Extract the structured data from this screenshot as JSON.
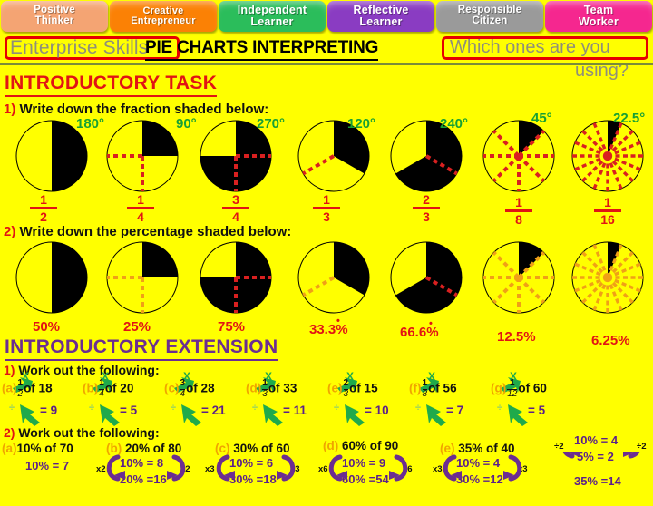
{
  "tabs": [
    {
      "line1": "Positive",
      "line2": "Thinker",
      "color": "#f4a473"
    },
    {
      "line1": "Creative",
      "line2": "Entrepreneur",
      "color": "#fb8105"
    },
    {
      "line1": "Independent",
      "line2": "Learner",
      "color": "#2bbd5b"
    },
    {
      "line1": "Reflective",
      "line2": "Learner",
      "color": "#8a3cc2"
    },
    {
      "line1": "Responsible",
      "line2": "Citizen",
      "color": "#9a9a9a"
    },
    {
      "line1": "Team",
      "line2": "Worker",
      "color": "#f5278f"
    }
  ],
  "header": {
    "enterprise_skills": "Enterprise Skills",
    "title": "PIE CHARTS INTERPRETING",
    "which_line1": "Which ones are you",
    "which_line2": "using?"
  },
  "sections": {
    "introductory_task": "INTRODUCTORY TASK",
    "introductory_extension": "INTRODUCTORY EXTENSION"
  },
  "questions": {
    "q1_num": "1)",
    "q1_text": " Write down the fraction shaded below:",
    "q2_num": "2)",
    "q2_text": " Write down the percentage shaded below:",
    "q3_num": "1)",
    "q3_text": " Work out the following:",
    "q4_num": "2)",
    "q4_text": " Work out the following:"
  },
  "chart_data": {
    "type": "pie",
    "title": "PIE CHARTS INTERPRETING",
    "row1_label": "Write down the fraction shaded below",
    "row2_label": "Write down the percentage shaded below",
    "series": [
      {
        "degrees": "180°",
        "fraction_num": "1",
        "fraction_den": "2",
        "percent": "50%",
        "shaded_deg": 180,
        "sectors": 2
      },
      {
        "degrees": "90°",
        "fraction_num": "1",
        "fraction_den": "4",
        "percent": "25%",
        "shaded_deg": 90,
        "sectors": 4
      },
      {
        "degrees": "270°",
        "fraction_num": "3",
        "fraction_den": "4",
        "percent": "75%",
        "shaded_deg": 270,
        "sectors": 4
      },
      {
        "degrees": "120°",
        "fraction_num": "1",
        "fraction_den": "3",
        "percent": "33.3%",
        "percent_dot": true,
        "shaded_deg": 120,
        "sectors": 3
      },
      {
        "degrees": "240°",
        "fraction_num": "2",
        "fraction_den": "3",
        "percent": "66.6%",
        "percent_dot": true,
        "shaded_deg": 240,
        "sectors": 3
      },
      {
        "degrees": "45°",
        "fraction_num": "1",
        "fraction_den": "8",
        "percent": "12.5%",
        "shaded_deg": 45,
        "sectors": 8
      },
      {
        "degrees": "22.5°",
        "fraction_num": "1",
        "fraction_den": "16",
        "percent": "6.25%",
        "shaded_deg": 22.5,
        "sectors": 16
      }
    ]
  },
  "extension1": [
    {
      "label": "(a)",
      "num": "1",
      "den": "2",
      "of": "of 18",
      "answer": "= 9"
    },
    {
      "label": "(b)",
      "num": "1",
      "den": "4",
      "of": "of 20",
      "answer": "= 5"
    },
    {
      "label": "(c)",
      "num": "3",
      "den": "4",
      "of": "of 28",
      "answer": "= 21"
    },
    {
      "label": "(d)",
      "num": "1",
      "den": "3",
      "of": "of 33",
      "answer": "= 11"
    },
    {
      "label": "(e)",
      "num": "2",
      "den": "3",
      "of": "of 15",
      "answer": "= 10"
    },
    {
      "label": "(f)",
      "num": "1",
      "den": "8",
      "of": "of 56",
      "answer": "= 7"
    },
    {
      "label": "(g)",
      "num": "1",
      "den": "12",
      "of": "of 60",
      "answer": "= 5"
    }
  ],
  "extension2": [
    {
      "label": "(a)",
      "question": "10% of 70",
      "lines": [
        "10% = 7"
      ],
      "mult_left": "",
      "mult_right": ""
    },
    {
      "label": "(b)",
      "question": "20% of 80",
      "lines": [
        "10% = 8",
        "20% =16"
      ],
      "mult_left": "x2",
      "mult_right": "x2"
    },
    {
      "label": "(c)",
      "question": "30% of 60",
      "lines": [
        "10% = 6",
        "30% =18"
      ],
      "mult_left": "x3",
      "mult_right": "x3"
    },
    {
      "label": "(d)",
      "question": "60% of 90",
      "lines": [
        "10% = 9",
        "60% =54"
      ],
      "mult_left": "x6",
      "mult_right": "x6"
    },
    {
      "label": "(e)",
      "question": "35% of 40",
      "lines": [
        "10% = 4",
        "30% =12"
      ],
      "mult_left": "x3",
      "mult_right": "x3",
      "extra": {
        "lines": [
          "10% = 4",
          "5% = 2"
        ],
        "mult_left": "÷2",
        "mult_right": "÷2",
        "total": "35% =14"
      }
    }
  ],
  "colors": {
    "background": "#ffff00",
    "red": "#e11414",
    "green": "#17a034",
    "purple": "#6b2d91",
    "answer_purple": "#5b1f8a",
    "orange_label": "#f0a500",
    "gray_text": "#8f8f7a",
    "spoke_red": "#d92020",
    "spoke_orange": "#f0a017"
  }
}
